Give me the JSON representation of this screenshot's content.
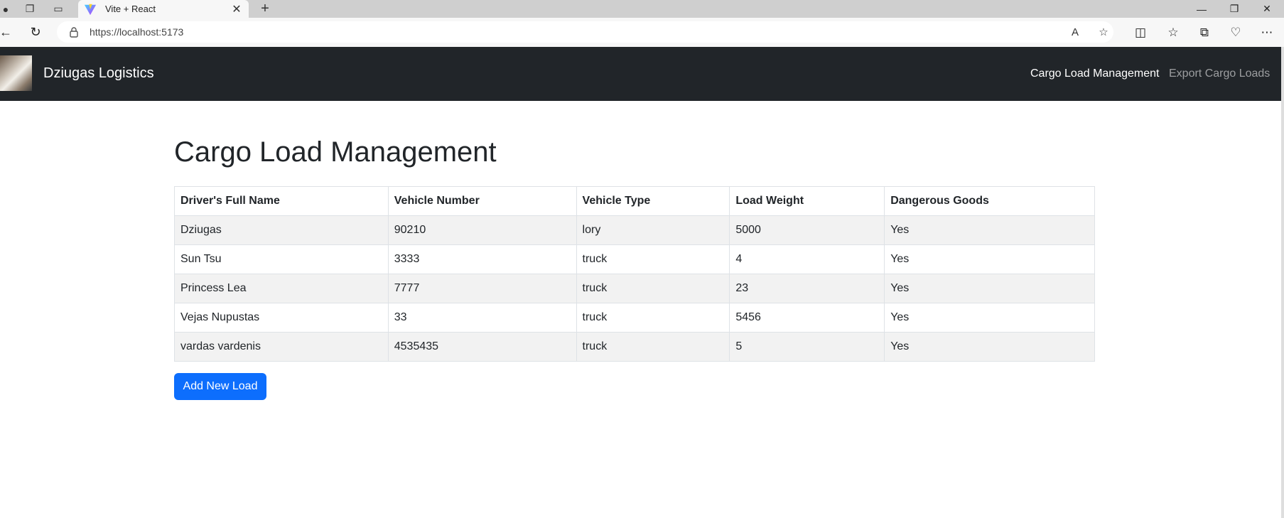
{
  "browser": {
    "tab_title": "Vite + React",
    "url": "https://localhost:5173"
  },
  "navbar": {
    "brand": "Dziugas Logistics",
    "links": [
      "Cargo Load Management",
      "Export Cargo Loads"
    ]
  },
  "main": {
    "title": "Cargo Load Management",
    "table": {
      "headers": [
        "Driver's Full Name",
        "Vehicle Number",
        "Vehicle Type",
        "Load Weight",
        "Dangerous Goods"
      ],
      "rows": [
        [
          "Dziugas",
          "90210",
          "lory",
          "5000",
          "Yes"
        ],
        [
          "Sun Tsu",
          "3333",
          "truck",
          "4",
          "Yes"
        ],
        [
          "Princess Lea",
          "7777",
          "truck",
          "23",
          "Yes"
        ],
        [
          "Vejas Nupustas",
          "33",
          "truck",
          "5456",
          "Yes"
        ],
        [
          "vardas vardenis",
          "4535435",
          "truck",
          "5",
          "Yes"
        ]
      ]
    },
    "add_button": "Add New Load"
  },
  "colors": {
    "navbar_bg": "#212529",
    "primary": "#0d6efd",
    "striped_row": "#f2f2f2"
  }
}
